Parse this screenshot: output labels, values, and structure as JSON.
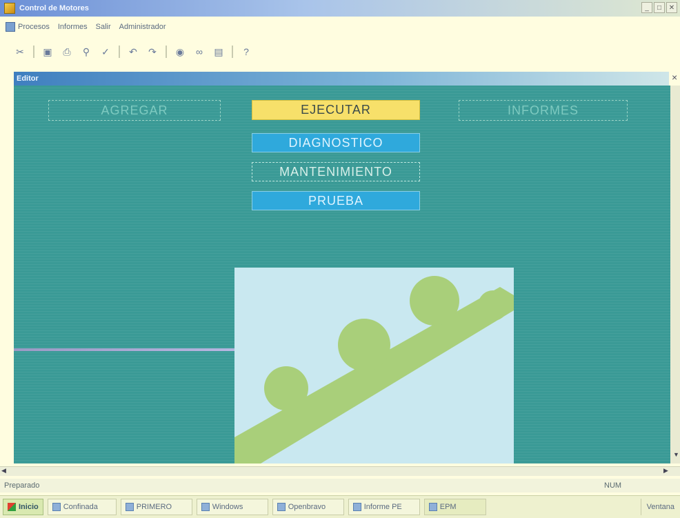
{
  "window": {
    "title": "Control de Motores"
  },
  "menu": {
    "items": [
      "Procesos",
      "Informes",
      "Salir",
      "Administrador"
    ]
  },
  "toolbar": {
    "icons": [
      "cut-icon",
      "save-icon",
      "print-icon",
      "print-preview-icon",
      "spelling-icon",
      "undo-icon",
      "redo-icon",
      "find-icon",
      "hyperlink-icon",
      "chart-icon",
      "help-icon"
    ]
  },
  "child_window": {
    "title": "Editor"
  },
  "buttons": {
    "agregar": "AGREGAR",
    "ejecutar": "EJECUTAR",
    "informes": "INFORMES",
    "diagnostico": "DIAGNOSTICO",
    "mantenimiento": "MANTENIMIENTO",
    "prueba": "PRUEBA"
  },
  "colors": {
    "panel": "#3a9a96",
    "ejecutar": "#f7e06a",
    "blue_button": "#2fa9dc",
    "graphic_bg": "#c9e8f0",
    "graphic_shape": "#a9cf7a"
  },
  "statusbar": {
    "left": "Preparado",
    "right": "NUM"
  },
  "taskbar": {
    "start": "Inicio",
    "items": [
      "Confinada",
      "PRIMERO",
      "Windows",
      "Openbravo",
      "Informe PE",
      "EPM"
    ],
    "tray": "Ventana"
  }
}
